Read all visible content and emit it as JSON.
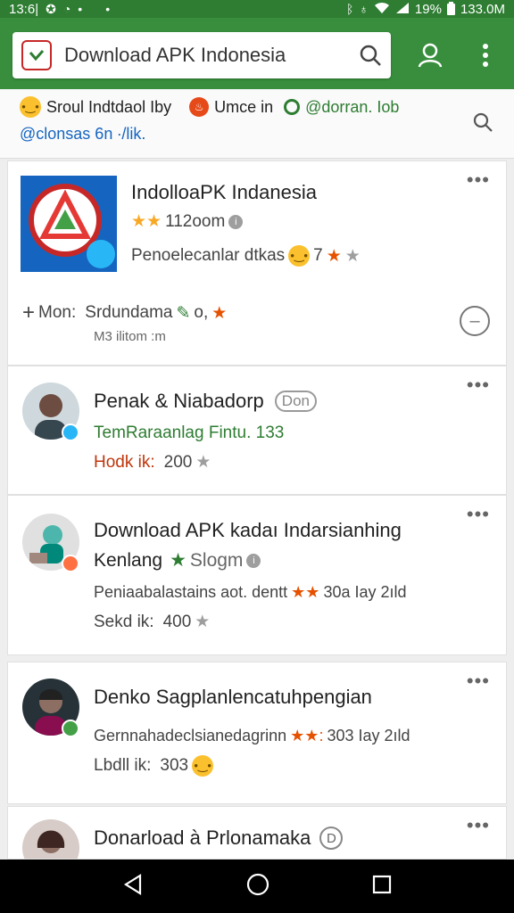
{
  "status_bar": {
    "time": "13:6|",
    "right_text": "133.0M",
    "battery_pct": "19%",
    "icons": [
      "settings-icon",
      "clock-icon",
      "dot-icon",
      "bluetooth-icon",
      "wifi-icon",
      "signal-icon",
      "battery-icon"
    ]
  },
  "toolbar": {
    "search_text": "Download APK Indonesia",
    "icons": [
      "app-logo-icon",
      "search-icon",
      "user-icon",
      "more-vert-icon"
    ]
  },
  "filter": {
    "chip1": "Sroul Indtdaol Iby",
    "chip2": "Umce in",
    "chip3": "@dorran. Iob",
    "row2": "@clonsas 6n ∙/lik."
  },
  "cards": [
    {
      "title": "IndolloaPK Indanesia",
      "rating": "112oom",
      "desc": "Penoelecanlar dtkas",
      "desc_suffix": "7",
      "action_prefix": "Mon:",
      "action": "Srdundama",
      "action_suffix": "o,",
      "sub": "M3 ilitom :m"
    },
    {
      "title": "Penak & Niabadorp",
      "title_tag": "Don",
      "meta": "TemRaraanlag Fintu. 133",
      "stat_label": "Hodk ik:",
      "stat_value": "200"
    },
    {
      "title": "Download APK kadaı Indarsianhing",
      "title2": "Kenlang",
      "rating": "Slogm",
      "desc": "Peniaabalastains aot. dentt",
      "desc_suffix": "30a Iay  2ıld",
      "stat_label": "Sekd ik:",
      "stat_value": "400"
    },
    {
      "title": "Denko Sagplanlencatuhpengian",
      "desc": "Gernnahadeclsianedagrinn",
      "desc_suffix": "303 Iay  2ıld",
      "stat_label": "Lbdll ik:",
      "stat_value": "303"
    },
    {
      "title": "Donarload à Prlonamaka",
      "title_tag": "D"
    }
  ],
  "colors": {
    "toolbar": "#388e3c",
    "status_bar": "#2e7d32",
    "star": "#f9a825",
    "link_blue": "#1565c0",
    "link_green": "#2e7d32"
  }
}
